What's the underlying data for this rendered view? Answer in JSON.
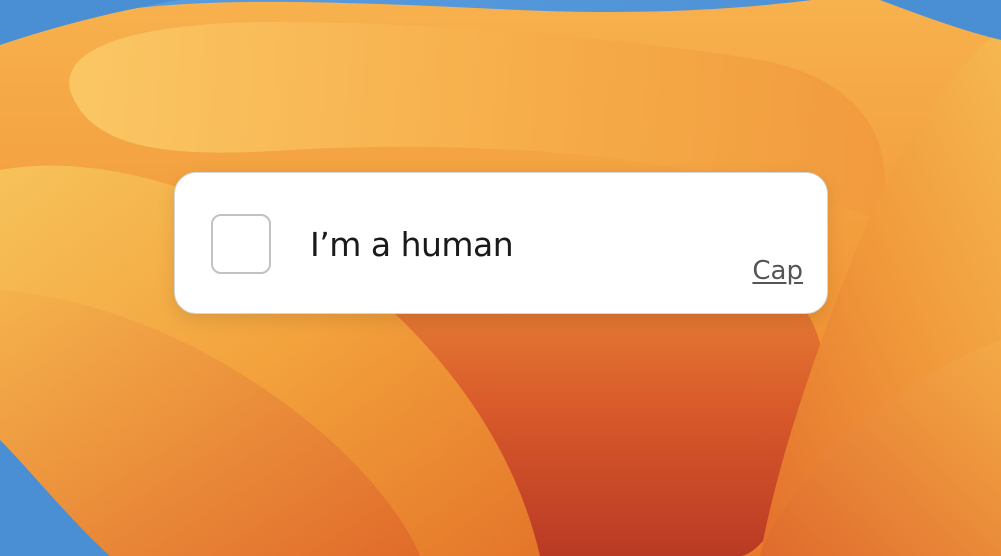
{
  "widget": {
    "checkbox_label": "I’m a human",
    "brand_link_text": "Cap",
    "checked": false
  },
  "colors": {
    "card_background": "#ffffff",
    "card_border": "#d6d6d6",
    "checkbox_border": "#c2c2c2",
    "label_text": "#1a1a1a",
    "link_text": "#555555",
    "wallpaper_blue": "#4a8fd4",
    "wallpaper_orange": "#f5a340",
    "wallpaper_deep_orange": "#e06a2a",
    "wallpaper_red": "#c8442a"
  }
}
